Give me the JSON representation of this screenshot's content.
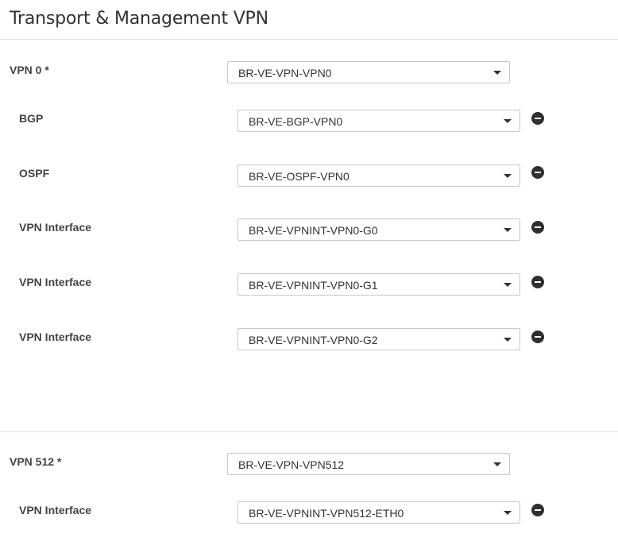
{
  "header": {
    "title": "Transport & Management VPN"
  },
  "vpn0": {
    "label": "VPN 0 *",
    "value": "BR-VE-VPN-VPN0",
    "children": [
      {
        "label": "BGP",
        "value": "BR-VE-BGP-VPN0"
      },
      {
        "label": "OSPF",
        "value": "BR-VE-OSPF-VPN0"
      },
      {
        "label": "VPN Interface",
        "value": "BR-VE-VPNINT-VPN0-G0"
      },
      {
        "label": "VPN Interface",
        "value": "BR-VE-VPNINT-VPN0-G1"
      },
      {
        "label": "VPN Interface",
        "value": "BR-VE-VPNINT-VPN0-G2"
      }
    ]
  },
  "vpn512": {
    "label": "VPN 512 *",
    "value": "BR-VE-VPN-VPN512",
    "children": [
      {
        "label": "VPN Interface",
        "value": "BR-VE-VPNINT-VPN512-ETH0"
      }
    ]
  }
}
